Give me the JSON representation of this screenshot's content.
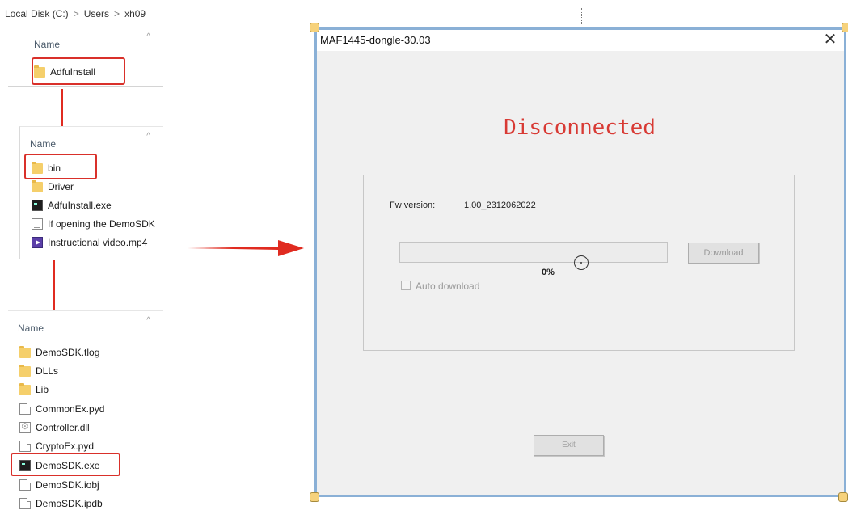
{
  "explorer": {
    "path": {
      "drive": "Local Disk (C:)",
      "sep": ">",
      "users": "Users",
      "user": "xh09"
    },
    "pane1": {
      "header": "Name",
      "items": [
        {
          "label": "AdfuInstall",
          "icon": "folder-icon"
        }
      ]
    },
    "pane2": {
      "header": "Name",
      "items": [
        {
          "label": "bin",
          "icon": "folder-icon"
        },
        {
          "label": "Driver",
          "icon": "folder-icon"
        },
        {
          "label": "AdfuInstall.exe",
          "icon": "terminal-exe-icon"
        },
        {
          "label": "If opening the DemoSDK",
          "icon": "text-file-icon"
        },
        {
          "label": "Instructional video.mp4",
          "icon": "video-file-icon"
        }
      ]
    },
    "pane3": {
      "header": "Name",
      "items": [
        {
          "label": "DemoSDK.tlog",
          "icon": "folder-icon"
        },
        {
          "label": "DLLs",
          "icon": "folder-icon"
        },
        {
          "label": "Lib",
          "icon": "folder-icon"
        },
        {
          "label": "CommonEx.pyd",
          "icon": "file-icon"
        },
        {
          "label": "Controller.dll",
          "icon": "dll-file-icon"
        },
        {
          "label": "CryptoEx.pyd",
          "icon": "file-icon"
        },
        {
          "label": "DemoSDK.exe",
          "icon": "terminal-exe-icon"
        },
        {
          "label": "DemoSDK.iobj",
          "icon": "file-icon"
        },
        {
          "label": "DemoSDK.ipdb",
          "icon": "file-icon"
        }
      ]
    }
  },
  "dialog": {
    "title": "MAF1445-dongle-30.03",
    "close_glyph": "✕",
    "status": "Disconnected",
    "fw_label": "Fw version:",
    "fw_value": "1.00_2312062022",
    "progress_percent": 0,
    "progress_text": "0%",
    "download_label": "Download",
    "auto_download_label": "Auto download",
    "auto_download_checked": false,
    "exit_label": "Exit"
  },
  "colors": {
    "highlight": "#d9302a",
    "arrow": "#e02b20",
    "status_text": "#d83a34",
    "guide": "#9a63d8"
  }
}
